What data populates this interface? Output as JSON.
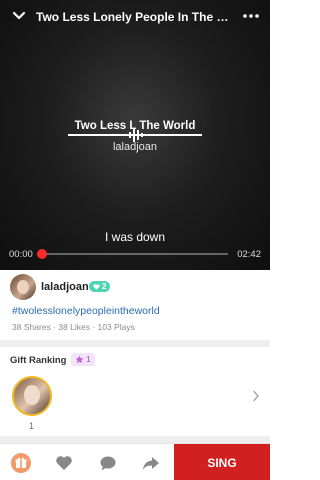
{
  "player": {
    "title": "Two Less Lonely People In The W...",
    "center_title": "Two Less L    The World",
    "center_user": "laladjoan",
    "lyric": "I was down",
    "time_elapsed": "00:00",
    "time_total": "02:42",
    "progress": 0.0,
    "accent_color": "#ff2a2a"
  },
  "user": {
    "name": "laladjoan",
    "badge": "2",
    "hashtag": "#twolesslonelypeopleintheworld",
    "stats": "38 Shares · 38 Likes · 103 Plays"
  },
  "gifts": {
    "title": "Gift Ranking",
    "count": "1",
    "top_rank": "1"
  },
  "bottom": {
    "icons": [
      "gift-icon",
      "heart-icon",
      "comment-icon",
      "share-icon"
    ],
    "sing_label": "SING",
    "sing_color": "#d21f1f"
  }
}
